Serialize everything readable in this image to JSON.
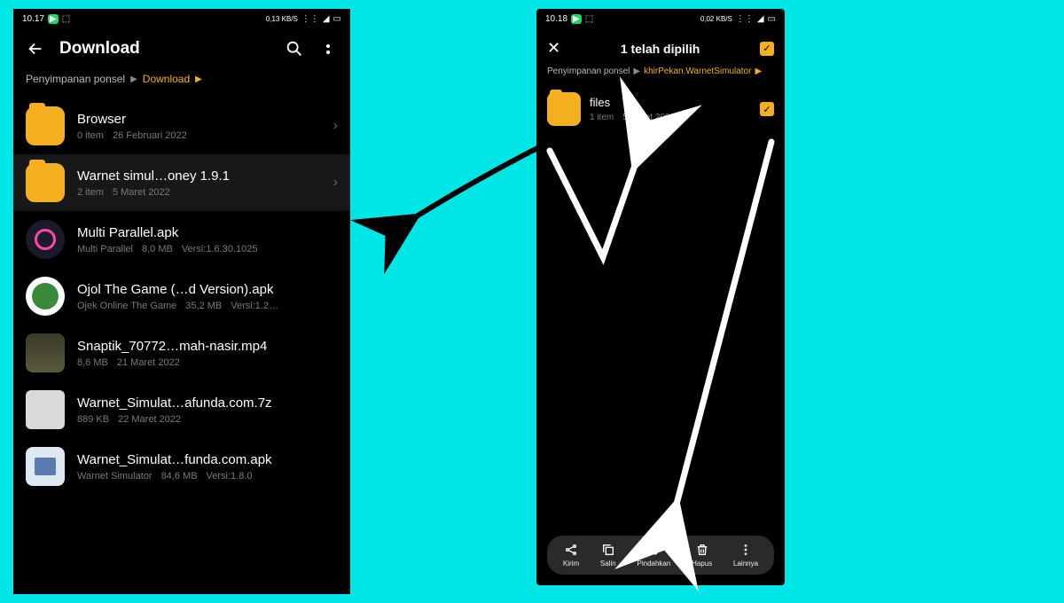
{
  "phone1": {
    "status": {
      "time": "10.17",
      "net": "0,13 KB/S"
    },
    "title": "Download",
    "breadcrumb": {
      "root": "Penyimpanan ponsel",
      "leaf": "Download"
    },
    "items": [
      {
        "name": "Browser",
        "sub1": "0 item",
        "sub2": "26 Februari 2022",
        "kind": "folder"
      },
      {
        "name": "Warnet simul…oney 1.9.1",
        "sub1": "2 item",
        "sub2": "5 Maret 2022",
        "kind": "folder",
        "selected": true
      },
      {
        "name": "Multi Parallel.apk",
        "sub1": "Multi Parallel",
        "sub2": "8,0 MB",
        "sub3": "Versi:1.6.30.1025",
        "kind": "pp"
      },
      {
        "name": "Ojol The Game (…d Version).apk",
        "sub1": "Ojek Online The Game",
        "sub2": "35,2 MB",
        "sub3": "Versi:1.2…",
        "kind": "green"
      },
      {
        "name": "Snaptik_70772…mah-nasir.mp4",
        "sub1": "8,6 MB",
        "sub2": "21 Maret 2022",
        "kind": "snap"
      },
      {
        "name": "Warnet_Simulat…afunda.com.7z",
        "sub1": "889 KB",
        "sub2": "22 Maret 2022",
        "kind": "gray"
      },
      {
        "name": "Warnet_Simulat…funda.com.apk",
        "sub1": "Warnet Simulator",
        "sub2": "84,6 MB",
        "sub3": "Versi:1.8.0",
        "kind": "wn"
      }
    ]
  },
  "phone2": {
    "status": {
      "time": "10.18",
      "net": "0,02 KB/S"
    },
    "title": "1 telah dipilih",
    "breadcrumb": {
      "root": "Penyimpanan ponsel",
      "leaf": "khirPekan.WarnetSimulator"
    },
    "item": {
      "name": "files",
      "sub1": "1 item",
      "sub2": "5 Maret 2022"
    },
    "actions": [
      {
        "label": "Kirim",
        "icon": "share"
      },
      {
        "label": "Salin",
        "icon": "copy"
      },
      {
        "label": "Pindahkan",
        "icon": "move"
      },
      {
        "label": "Hapus",
        "icon": "trash"
      },
      {
        "label": "Lainnya",
        "icon": "more"
      }
    ]
  }
}
